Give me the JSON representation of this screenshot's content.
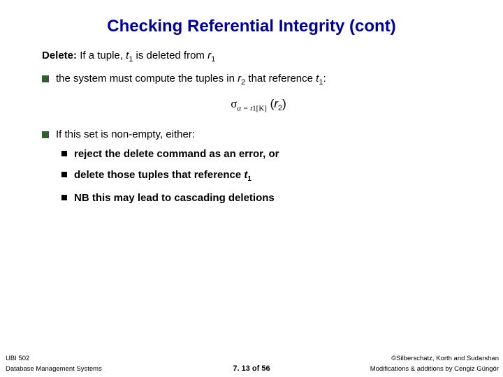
{
  "title": "Checking Referential Integrity (cont)",
  "delete_label": "Delete:",
  "delete_text_a": "If a tuple, ",
  "delete_t1": "t",
  "delete_t1_sub": "1",
  "delete_text_b": " is deleted from ",
  "delete_r1": "r",
  "delete_r1_sub": "1",
  "b1_a": "the system must compute the tuples in ",
  "b1_r2": "r",
  "b1_r2_sub": "2",
  "b1_b": " that reference ",
  "b1_t1": "t",
  "b1_t1_sub": "1",
  "b1_c": ":",
  "formula_sigma": "σ",
  "formula_alpha": "α",
  "formula_eq": " = ",
  "formula_t": "t",
  "formula_t_sub": "1",
  "formula_br_open": "[K]",
  "formula_r": "r",
  "formula_r_sub": "2",
  "b2": "If this set is non-empty, either:",
  "s1": "reject the delete command as an error, or",
  "s2_a": "delete those tuples that reference ",
  "s2_t": "t",
  "s2_t_sub": "1",
  "s3": "NB this may lead to cascading deletions",
  "footer_course": "UBI 502",
  "footer_copyright": "©Silberschatz, Korth and Sudarshan",
  "footer_dbms": "Database Management Systems",
  "footer_mod": "Modifications & additions by Cengiz Güngör",
  "footer_page": "7. 13 of 56"
}
